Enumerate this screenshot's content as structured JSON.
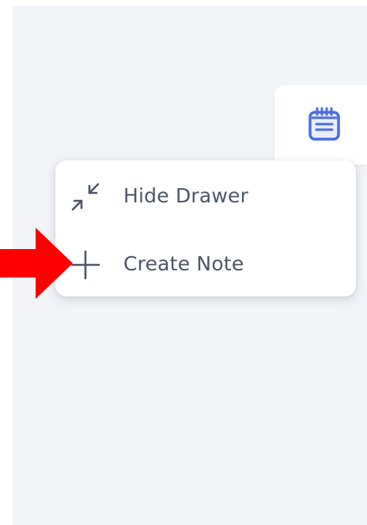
{
  "drawer_tab": {
    "icon": "notepad-icon"
  },
  "menu": {
    "items": [
      {
        "label": "Hide Drawer",
        "icon": "collapse-arrows-icon"
      },
      {
        "label": "Create Note",
        "icon": "plus-icon"
      }
    ]
  },
  "annotation": {
    "icon": "red-arrow-icon",
    "color": "#ff0000"
  },
  "colors": {
    "background": "#f2f4f8",
    "menu_text": "#4d5668",
    "accent_blue": "#4a6ee0"
  }
}
